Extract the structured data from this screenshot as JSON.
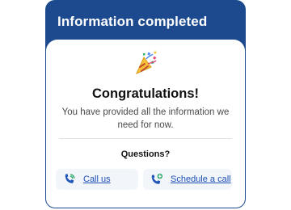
{
  "header": {
    "title": "Information completed"
  },
  "main": {
    "emoji": "party-popper-icon",
    "title": "Congratulations!",
    "description": "You have provided all the information we need for now.",
    "questions_label": "Questions?",
    "actions": [
      {
        "label": "Call us",
        "icon": "phone-call-icon"
      },
      {
        "label": "Schedule a call",
        "icon": "phone-add-icon"
      }
    ]
  },
  "colors": {
    "header_bg": "#1d4a8f",
    "link": "#1c4fb5",
    "action_bg": "#f2f5fa",
    "icon_blue": "#1f56b8",
    "icon_green": "#2aa86a"
  }
}
